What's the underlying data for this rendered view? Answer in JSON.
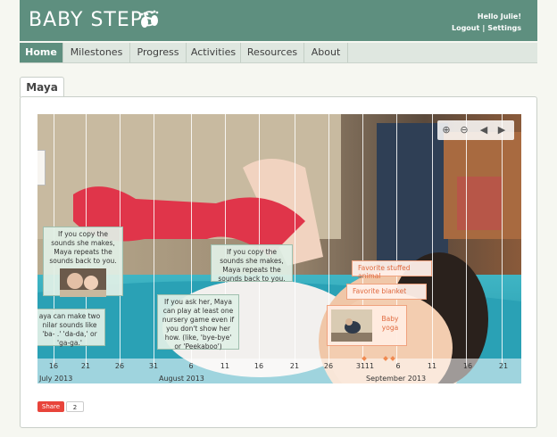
{
  "header": {
    "logo": "BABY STEPS",
    "greeting": "Hello Julie!",
    "logout": "Logout",
    "settings": "Settings"
  },
  "nav": {
    "tabs": [
      {
        "label": "Home",
        "active": true
      },
      {
        "label": "Milestones",
        "active": false
      },
      {
        "label": "Progress",
        "active": false
      },
      {
        "label": "Activities",
        "active": false
      },
      {
        "label": "Resources",
        "active": false
      },
      {
        "label": "About",
        "active": false
      }
    ]
  },
  "child_tab": "Maya",
  "timeline": {
    "day_ticks": [
      "16",
      "21",
      "26",
      "31",
      "6",
      "11",
      "16",
      "21",
      "26",
      "31",
      "11",
      "6",
      "11",
      "16",
      "21"
    ],
    "months": [
      "July 2013",
      "August 2013",
      "September 2013"
    ],
    "notes": [
      "If you copy the sounds she makes, Maya repeats the sounds back to you.",
      "If you copy the sounds she makes, Maya repeats the sounds back to you.",
      "aya can make two nilar sounds like 'ba- .' 'da-da,' or 'ga-ga.'",
      "If you ask her, Maya can play at least one nursery game even if you don't show her how. (like, 'bye-bye' or 'Peekaboo')"
    ],
    "events": [
      "Favorite stuffed animal",
      "Favorite blanket",
      "Baby yoga"
    ],
    "colors": {
      "note_border": "#9fbfae",
      "event": "#e06a3f"
    }
  },
  "share": {
    "label": "Share",
    "count": "2"
  }
}
